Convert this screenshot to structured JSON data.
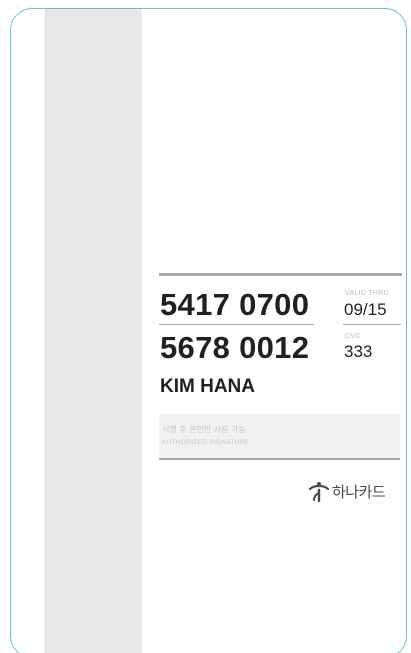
{
  "card": {
    "number_line1": "5417 0700",
    "number_line2": "5678 0012",
    "valid_thru_label": "VALID THRU",
    "valid_thru_value": "09/15",
    "cvc_label": "CVC",
    "cvc_value": "333",
    "holder_name": "KIM HANA",
    "signature_text_kr": "서명 후 본인만 사용 가능",
    "signature_text_en": "AUTHORIZED SIGNATURE",
    "brand_icon": "hana-logo-icon",
    "brand_name": "하나카드"
  },
  "colors": {
    "card_border": "#5ec8cf",
    "stripe": "#e7e8ea",
    "rule": "#a7a8aa",
    "text": "#231f20",
    "signature_panel": "#f1f1f2"
  }
}
